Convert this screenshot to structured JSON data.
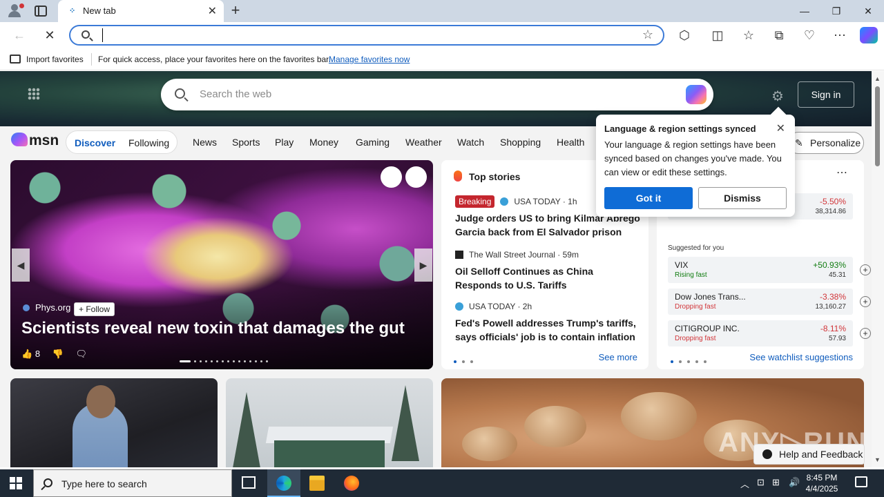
{
  "browser": {
    "tab_title": "New tab",
    "address_value": "",
    "favorites_bar": {
      "import_label": "Import favorites",
      "message": "For quick access, place your favorites here on the favorites bar.",
      "manage_link": "Manage favorites now"
    }
  },
  "msn": {
    "search_placeholder": "Search the web",
    "sign_in": "Sign in",
    "logo_text": "msn",
    "feed_tabs": [
      "Discover",
      "Following"
    ],
    "nav_links": [
      "News",
      "Sports",
      "Play",
      "Money",
      "Gaming",
      "Weather",
      "Watch",
      "Shopping",
      "Health"
    ],
    "personalize": "Personalize",
    "hero_story": {
      "source": "Phys.org",
      "follow": "+ Follow",
      "headline": "Scientists reveal new toxin that damages the gut",
      "likes": "8"
    },
    "top_stories": {
      "heading": "Top stories",
      "items": [
        {
          "badge": "Breaking",
          "publisher": "USA TODAY · 1h",
          "title": "Judge orders US to bring Kilmar Abrego Garcia back from El Salvador prison"
        },
        {
          "badge": "",
          "publisher": "The Wall Street Journal · 59m",
          "title": "Oil Selloff Continues as China Responds to U.S. Tariffs"
        },
        {
          "badge": "",
          "publisher": "USA TODAY · 2h",
          "title": "Fed's Powell addresses Trump's tariffs, says officials' job is to contain inflation"
        }
      ],
      "see_more": "See more"
    },
    "market": {
      "top_row": {
        "change": "-5.50%",
        "price": "38,314.86"
      },
      "suggested_label": "Suggested for you",
      "suggested": [
        {
          "name": "VIX",
          "status": "Rising fast",
          "change": "+50.93%",
          "price": "45.31",
          "direction": "up"
        },
        {
          "name": "Dow Jones Trans...",
          "status": "Dropping fast",
          "change": "-3.38%",
          "price": "13,160.27",
          "direction": "down"
        },
        {
          "name": "CITIGROUP INC.",
          "status": "Dropping fast",
          "change": "-8.11%",
          "price": "57.93",
          "direction": "down"
        }
      ],
      "watchlist_link": "See watchlist suggestions"
    },
    "popup": {
      "title": "Language & region settings synced",
      "body": "Your language & region settings have been synced based on changes you've made. You can view or edit these settings.",
      "primary": "Got it",
      "secondary": "Dismiss"
    },
    "help": "Help and Feedback"
  },
  "taskbar": {
    "search_placeholder": "Type here to search",
    "time": "8:45 PM",
    "date": "4/4/2025"
  },
  "colors": {
    "accent": "#0f6cd6",
    "link": "#0f5cbd",
    "breaking": "#c4262e",
    "gain": "#107c10",
    "loss": "#d13438"
  }
}
